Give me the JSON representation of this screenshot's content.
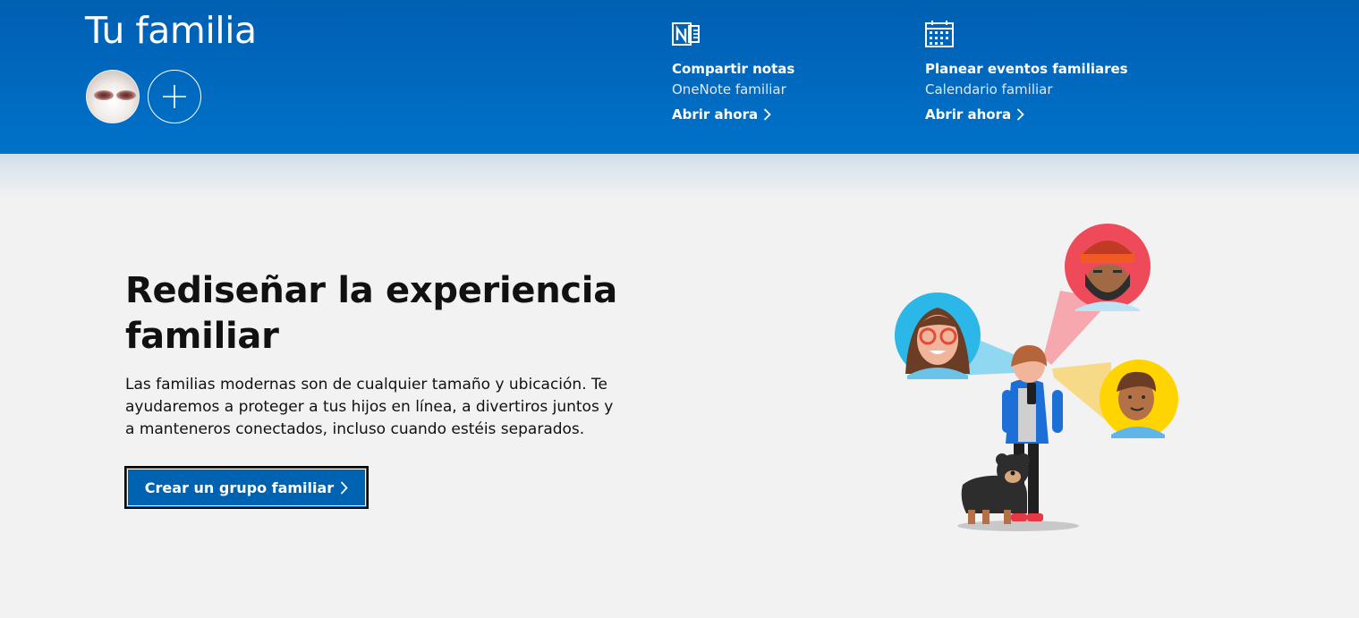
{
  "header": {
    "title": "Tu familia",
    "cards": [
      {
        "icon": "onenote-icon",
        "title": "Compartir notas",
        "subtitle": "OneNote familiar",
        "link": "Abrir ahora"
      },
      {
        "icon": "calendar-icon",
        "title": "Planear eventos familiares",
        "subtitle": "Calendario familiar",
        "link": "Abrir ahora"
      }
    ]
  },
  "hero": {
    "title": "Rediseñar la experiencia familiar",
    "description": "Las familias modernas son de cualquier tamaño y ubicación. Te ayudaremos a proteger a tus hijos en línea, a divertiros juntos y a manteneros conectados, incluso cuando estéis separados.",
    "cta_label": "Crear un grupo familiar"
  },
  "colors": {
    "header_top": "#005fb2",
    "header_bottom": "#0072c9",
    "cta": "#0063b1",
    "background": "#f2f2f2"
  }
}
